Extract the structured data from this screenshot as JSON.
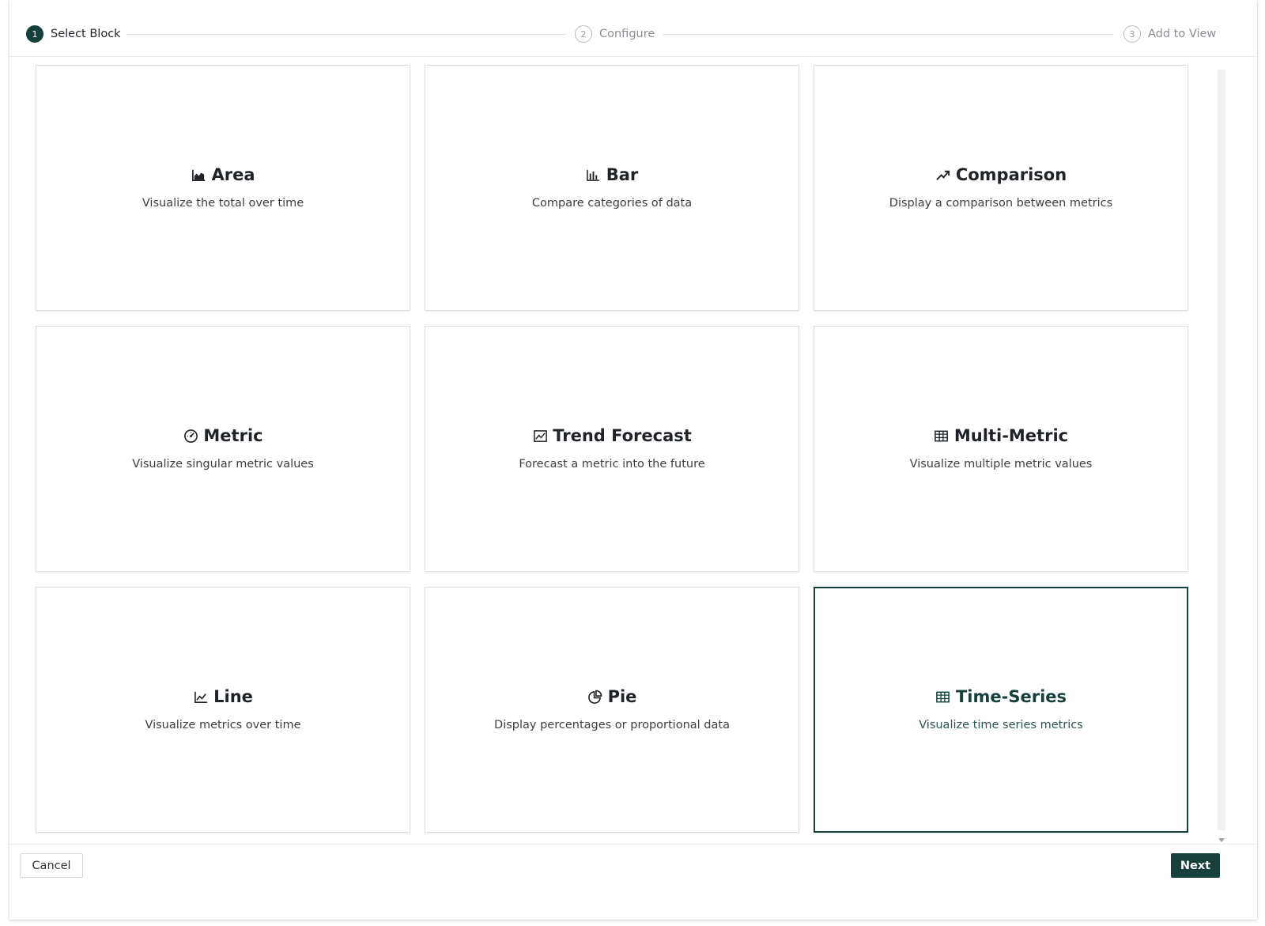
{
  "stepper": {
    "steps": [
      {
        "number": "1",
        "label": "Select Block",
        "state": "active"
      },
      {
        "number": "2",
        "label": "Configure",
        "state": "inactive"
      },
      {
        "number": "3",
        "label": "Add to View",
        "state": "inactive"
      }
    ]
  },
  "cards": [
    {
      "title": "Area",
      "description": "Visualize the total over time",
      "icon": "area-chart-icon",
      "selected": false
    },
    {
      "title": "Bar",
      "description": "Compare categories of data",
      "icon": "bar-chart-icon",
      "selected": false
    },
    {
      "title": "Comparison",
      "description": "Display a comparison between metrics",
      "icon": "trend-up-icon",
      "selected": false
    },
    {
      "title": "Metric",
      "description": "Visualize singular metric values",
      "icon": "gauge-icon",
      "selected": false
    },
    {
      "title": "Trend Forecast",
      "description": "Forecast a metric into the future",
      "icon": "framed-line-chart-icon",
      "selected": false
    },
    {
      "title": "Multi-Metric",
      "description": "Visualize multiple metric values",
      "icon": "table-grid-icon",
      "selected": false
    },
    {
      "title": "Line",
      "description": "Visualize metrics over time",
      "icon": "line-chart-icon",
      "selected": false
    },
    {
      "title": "Pie",
      "description": "Display percentages or proportional data",
      "icon": "pie-chart-icon",
      "selected": false
    },
    {
      "title": "Time-Series",
      "description": "Visualize time series metrics",
      "icon": "table-grid-icon",
      "selected": true
    }
  ],
  "footer": {
    "cancel_label": "Cancel",
    "next_label": "Next"
  },
  "colors": {
    "accent": "#17403a",
    "card_border": "#dcdfe2",
    "muted_text": "#8a8e93"
  }
}
